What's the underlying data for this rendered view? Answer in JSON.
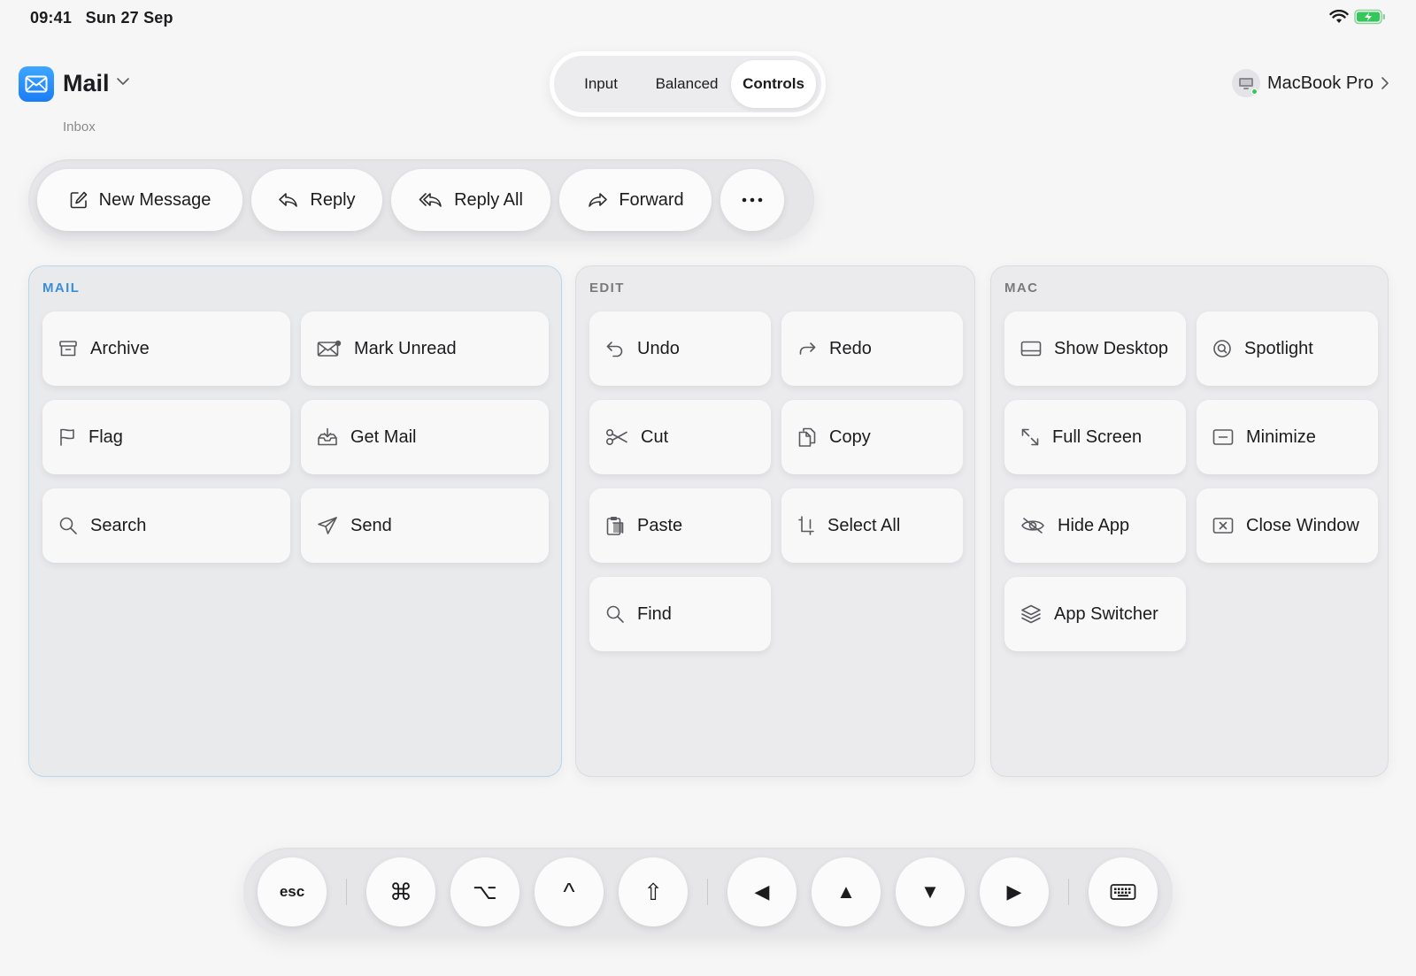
{
  "status": {
    "time": "09:41",
    "date": "Sun 27 Sep"
  },
  "app": {
    "title": "Mail",
    "subtitle": "Inbox",
    "accent": "#1a7cf5"
  },
  "segmented": {
    "options": [
      "Input",
      "Balanced",
      "Controls"
    ],
    "selected": "Controls"
  },
  "device": {
    "name": "MacBook Pro",
    "status_color": "#34c759"
  },
  "quick_actions": [
    {
      "label": "New Message",
      "icon": "compose-icon"
    },
    {
      "label": "Reply",
      "icon": "reply-icon"
    },
    {
      "label": "Reply All",
      "icon": "reply-all-icon"
    },
    {
      "label": "Forward",
      "icon": "forward-icon"
    },
    {
      "label": "",
      "icon": "more-icon"
    }
  ],
  "panels": {
    "mail": {
      "title": "MAIL",
      "items": [
        {
          "label": "Archive",
          "icon": "archive-icon"
        },
        {
          "label": "Mark Unread",
          "icon": "envelope-unread-icon"
        },
        {
          "label": "Flag",
          "icon": "flag-icon"
        },
        {
          "label": "Get Mail",
          "icon": "tray-download-icon"
        },
        {
          "label": "Search",
          "icon": "search-icon"
        },
        {
          "label": "Send",
          "icon": "paperplane-icon"
        }
      ]
    },
    "edit": {
      "title": "EDIT",
      "items": [
        {
          "label": "Undo",
          "icon": "undo-icon"
        },
        {
          "label": "Redo",
          "icon": "redo-icon"
        },
        {
          "label": "Cut",
          "icon": "scissors-icon"
        },
        {
          "label": "Copy",
          "icon": "copy-icon"
        },
        {
          "label": "Paste",
          "icon": "clipboard-icon"
        },
        {
          "label": "Select All",
          "icon": "select-all-icon"
        },
        {
          "label": "Find",
          "icon": "search-icon"
        }
      ]
    },
    "mac": {
      "title": "MAC",
      "items": [
        {
          "label": "Show Desktop",
          "icon": "desktop-icon"
        },
        {
          "label": "Spotlight",
          "icon": "spotlight-icon"
        },
        {
          "label": "Full Screen",
          "icon": "expand-icon"
        },
        {
          "label": "Minimize",
          "icon": "minimize-icon"
        },
        {
          "label": "Hide App",
          "icon": "eye-slash-icon"
        },
        {
          "label": "Close Window",
          "icon": "close-window-icon"
        },
        {
          "label": "App Switcher",
          "icon": "layers-icon"
        }
      ]
    }
  },
  "keys": {
    "esc": "esc",
    "modifiers": [
      "⌘",
      "⌥",
      "^",
      "⇧"
    ],
    "arrows": [
      "◀",
      "▲",
      "▼",
      "▶"
    ],
    "keyboard_icon": "keyboard-icon"
  }
}
